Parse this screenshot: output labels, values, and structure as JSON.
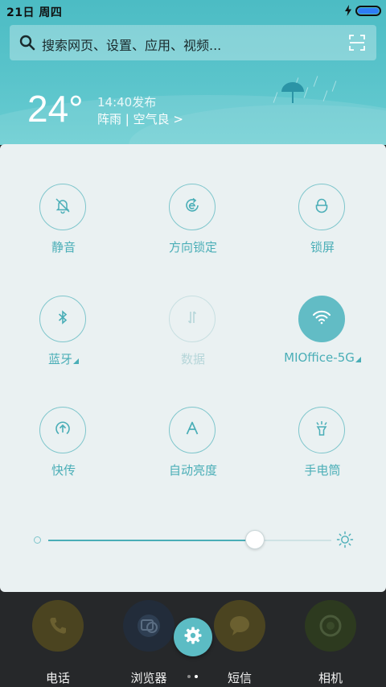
{
  "status_bar": {
    "date_text": "21日 周四",
    "charging": true,
    "battery_color": "#2e7cf6"
  },
  "search": {
    "placeholder": "搜索网页、设置、应用、视频..."
  },
  "weather": {
    "temperature": "24°",
    "updated": "14:40发布",
    "description": "阵雨 | 空气良 >"
  },
  "quick_settings": {
    "tiles": [
      {
        "label": "静音",
        "icon": "bell-off-icon",
        "state": "off"
      },
      {
        "label": "方向锁定",
        "icon": "rotation-lock-icon",
        "state": "off"
      },
      {
        "label": "锁屏",
        "icon": "lock-icon",
        "state": "off"
      },
      {
        "label": "蓝牙",
        "icon": "bluetooth-icon",
        "state": "off",
        "expandable": true
      },
      {
        "label": "数据",
        "icon": "mobile-data-icon",
        "state": "disabled"
      },
      {
        "label": "MIOffice-5G",
        "icon": "wifi-icon",
        "state": "on",
        "expandable": true
      },
      {
        "label": "快传",
        "icon": "transfer-icon",
        "state": "off"
      },
      {
        "label": "自动亮度",
        "icon": "auto-brightness-icon",
        "state": "off"
      },
      {
        "label": "手电筒",
        "icon": "flashlight-icon",
        "state": "off"
      }
    ],
    "brightness_level": 0.73,
    "accent_color": "#4aaeb7"
  },
  "dock": {
    "apps": [
      {
        "label": "电话",
        "icon": "phone-icon"
      },
      {
        "label": "浏览器",
        "icon": "browser-icon"
      },
      {
        "label": "短信",
        "icon": "message-icon"
      },
      {
        "label": "相机",
        "icon": "camera-icon"
      }
    ],
    "settings_button_icon": "gear-icon",
    "page_count": 2,
    "current_page": 2
  }
}
